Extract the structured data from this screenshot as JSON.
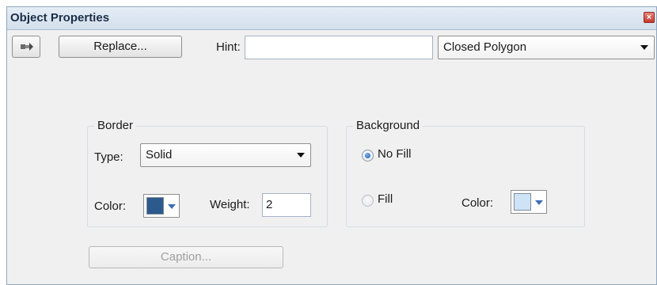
{
  "window": {
    "title": "Object Properties",
    "close_icon": "close-icon"
  },
  "toolbar": {
    "icon_button": "pin-arrow-icon",
    "replace_label": "Replace...",
    "hint_label": "Hint:",
    "hint_value": "",
    "shape_select": "Closed Polygon"
  },
  "border": {
    "title": "Border",
    "type_label": "Type:",
    "type_value": "Solid",
    "color_label": "Color:",
    "color_value": "#2c5a8c",
    "weight_label": "Weight:",
    "weight_value": "2"
  },
  "background": {
    "title": "Background",
    "no_fill_label": "No Fill",
    "no_fill_selected": true,
    "fill_label": "Fill",
    "fill_selected": false,
    "color_label": "Color:",
    "color_value": "#cfe3f7"
  },
  "caption_button": "Caption..."
}
